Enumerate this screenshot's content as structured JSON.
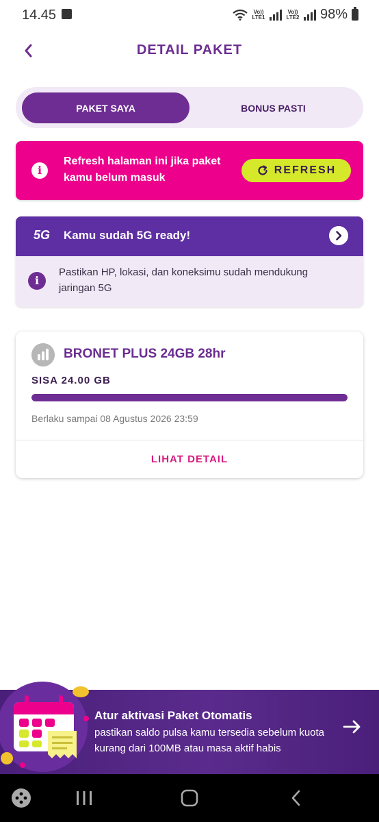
{
  "status": {
    "time": "14.45",
    "sim1_label": "Vo)) LTE1",
    "sim2_label": "Vo)) LTE2",
    "battery": "98%"
  },
  "header": {
    "title": "DETAIL PAKET"
  },
  "tabs": [
    {
      "label": "PAKET SAYA",
      "active": true
    },
    {
      "label": "BONUS PASTI",
      "active": false
    }
  ],
  "refresh": {
    "message": "Refresh halaman ini jika paket kamu belum masuk",
    "button_label": "REFRESH"
  },
  "fiveg": {
    "logo": "5G",
    "title": "Kamu sudah 5G ready!",
    "info": "Pastikan HP, lokasi, dan koneksimu sudah mendukung jaringan 5G"
  },
  "package": {
    "name": "BRONET PLUS 24GB 28hr",
    "remaining": "SISA 24.00 GB",
    "remaining_fraction": 1.0,
    "valid_until": "Berlaku sampai 08 Agustus 2026 23:59",
    "detail_link": "LIHAT DETAIL"
  },
  "promo": {
    "title": "Atur aktivasi Paket Otomatis",
    "body": "pastikan saldo pulsa kamu tersedia sebelum kuota kurang dari 100MB atau masa aktif habis"
  },
  "colors": {
    "primary": "#6e2d93",
    "magenta": "#ec008c",
    "lime": "#d6e82a",
    "fiveg_header": "#5e2fa2"
  }
}
